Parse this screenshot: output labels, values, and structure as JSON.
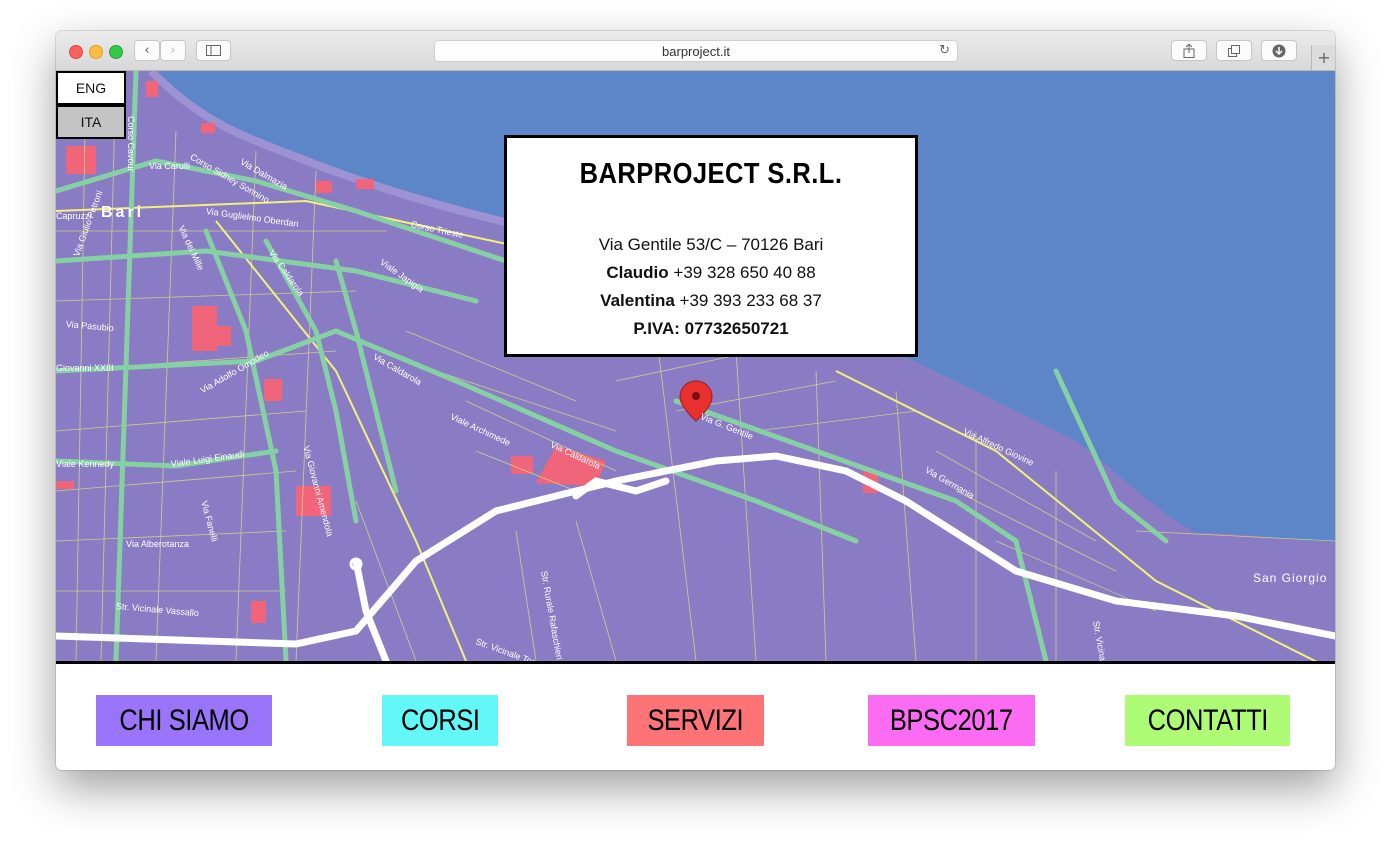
{
  "browser": {
    "url": "barproject.it"
  },
  "language": {
    "options": [
      "ENG",
      "ITA"
    ],
    "selected": "ITA"
  },
  "info": {
    "company": "BARPROJECT S.R.L.",
    "address": "Via Gentile 53/C – 70126 Bari",
    "contacts": [
      {
        "name": "Claudio",
        "phone": "+39 328 650 40 88"
      },
      {
        "name": "Valentina",
        "phone": "+39 393 233 68 37"
      }
    ],
    "vat": "P.IVA: 07732650721"
  },
  "map": {
    "city_label": "Bari",
    "street_labels": [
      "Corso Cavour",
      "Via Carulli",
      "Corso Sidney Sonnino",
      "Via Dalmazia",
      "Via Guglielmo Oberdan",
      "Corso Trieste",
      "Via Caldarola",
      "Viale Japigia",
      "Via dei Mille",
      "Via Giulio Petroni",
      "Via Pasubio",
      "Giovanni XXIII",
      "Via Adolfo Omodeo",
      "Viale Luigi Einaudi",
      "Via Giovanni Amendola",
      "Viale Archimede",
      "Via G. Gentile",
      "Via Alfredo Giovine",
      "Via Germania",
      "Via Fanelli",
      "Via Alberotanza",
      "Str. Vicinale Vassallo",
      "Str. Rurale Rafaschieri",
      "Str. Vicinale Torre",
      "San Giorgio",
      "Viale Kennedy",
      "Capruzzi",
      "Str. Vicinale"
    ],
    "colors": {
      "land": "#8a7cc4",
      "sea": "#5c86c8",
      "main_road": "#86d1a3",
      "highway": "#ffffff",
      "minor_road": "#e6e87a",
      "block": "#f0657a",
      "marker": "#e8312f"
    },
    "marker_icon": "map-pin-icon"
  },
  "nav": {
    "items": [
      {
        "label": "CHI SIAMO",
        "color": "#9a75fb"
      },
      {
        "label": "CORSI",
        "color": "#63f7f7"
      },
      {
        "label": "SERVIZI",
        "color": "#fc7476"
      },
      {
        "label": "BPSC2017",
        "color": "#fb6cf3"
      },
      {
        "label": "CONTATTI",
        "color": "#aefb76"
      }
    ]
  }
}
